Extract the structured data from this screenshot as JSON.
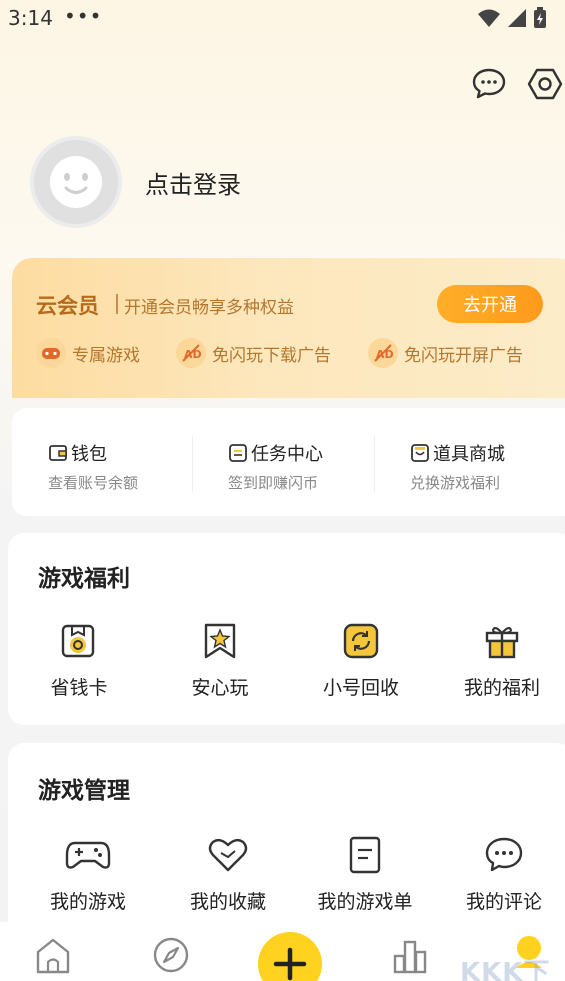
{
  "status_bar": {
    "time": "3:14",
    "dots": "•••"
  },
  "header": {
    "message_icon": "chat-bubble-icon",
    "settings_icon": "hexagon-settings-icon"
  },
  "profile": {
    "login_label": "点击登录"
  },
  "vip": {
    "title": "云会员",
    "subtitle": "开通会员畅享多种权益",
    "button": "去开通",
    "perks": [
      {
        "label": "专属游戏",
        "icon": "gamepad-badge-icon"
      },
      {
        "label": "免闪玩下载广告",
        "icon": "no-ad-icon"
      },
      {
        "label": "免闪玩开屏广告",
        "icon": "no-ad-icon"
      }
    ]
  },
  "quick": [
    {
      "title": "钱包",
      "sub": "查看账号余额",
      "icon": "wallet-icon"
    },
    {
      "title": "任务中心",
      "sub": "签到即赚闪币",
      "icon": "task-icon"
    },
    {
      "title": "道具商城",
      "sub": "兑换游戏福利",
      "icon": "shop-icon"
    }
  ],
  "welfare": {
    "title": "游戏福利",
    "items": [
      {
        "label": "省钱卡",
        "icon": "saving-card-icon"
      },
      {
        "label": "安心玩",
        "icon": "star-bookmark-icon"
      },
      {
        "label": "小号回收",
        "icon": "recycle-icon"
      },
      {
        "label": "我的福利",
        "icon": "gift-icon"
      }
    ]
  },
  "manage": {
    "title": "游戏管理",
    "items": [
      {
        "label": "我的游戏",
        "icon": "gamepad-icon"
      },
      {
        "label": "我的收藏",
        "icon": "heart-icon"
      },
      {
        "label": "我的游戏单",
        "icon": "list-icon"
      },
      {
        "label": "我的评论",
        "icon": "comment-icon"
      }
    ]
  },
  "bottom_nav": {
    "items": [
      "home-icon",
      "discover-icon",
      "plus-icon",
      "ranking-icon",
      "profile-icon"
    ]
  },
  "watermark": "KKK下载"
}
